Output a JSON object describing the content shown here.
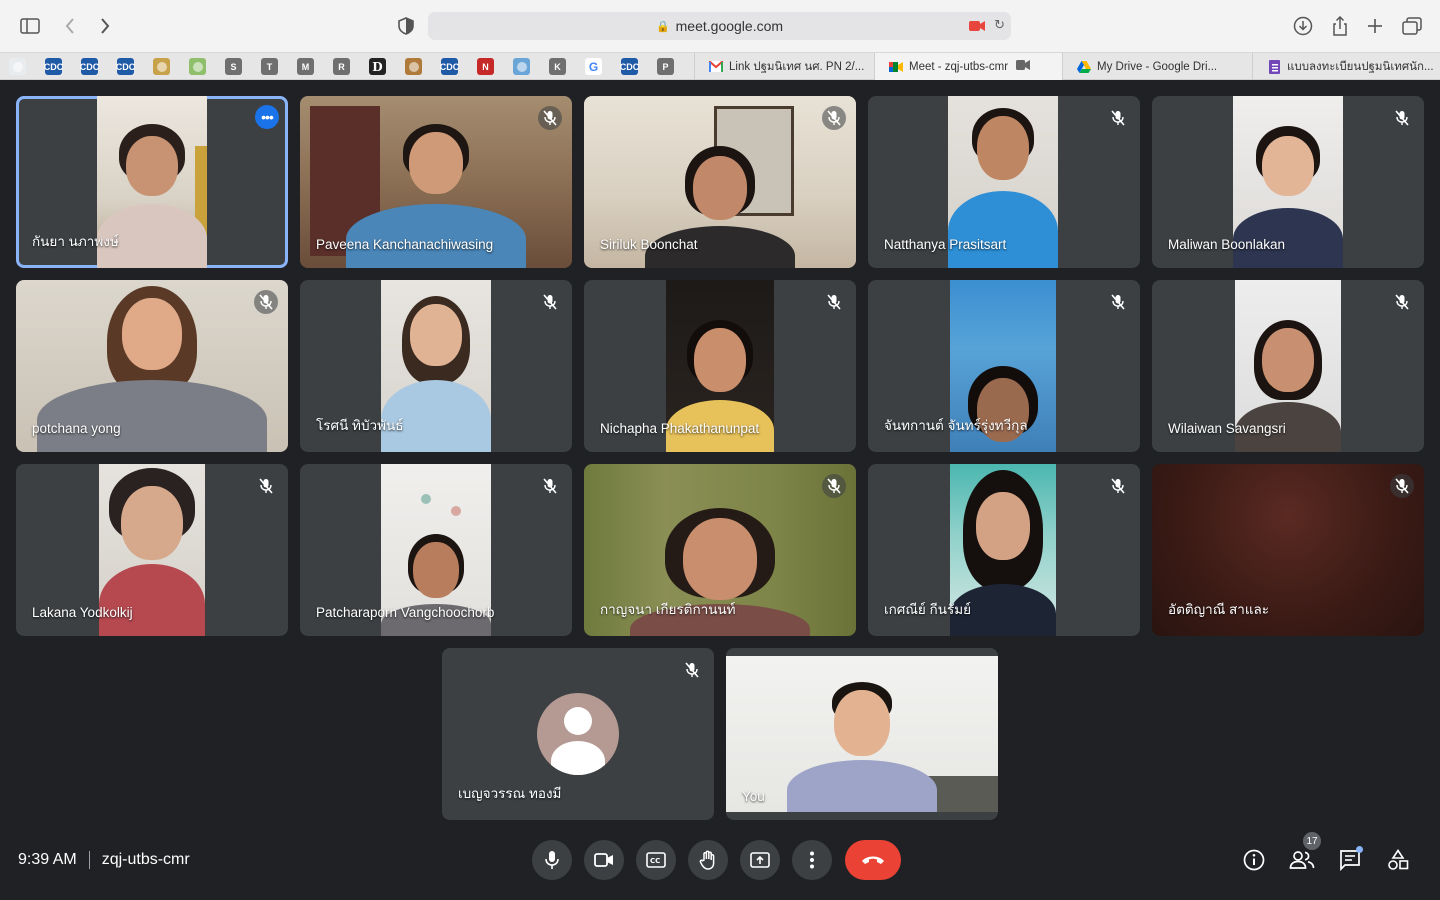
{
  "browser": {
    "url": "meet.google.com",
    "pinned_tabs": [
      {
        "label": "",
        "color": "#e9ecef",
        "icon": "heart-icon"
      },
      {
        "label": "CDC",
        "color": "#1f5aa6"
      },
      {
        "label": "CDC",
        "color": "#1f5aa6"
      },
      {
        "label": "CDC",
        "color": "#1f5aa6"
      },
      {
        "label": "",
        "color": "#c8a24a",
        "icon": "seal-icon"
      },
      {
        "label": "",
        "color": "#8fbf6a",
        "icon": "globe-icon"
      },
      {
        "label": "S",
        "color": "#6f6f6f"
      },
      {
        "label": "T",
        "color": "#6f6f6f"
      },
      {
        "label": "M",
        "color": "#6f6f6f"
      },
      {
        "label": "R",
        "color": "#6f6f6f"
      },
      {
        "label": "D",
        "color": "#222222"
      },
      {
        "label": "",
        "color": "#b07a3a",
        "icon": "crest-icon"
      },
      {
        "label": "CDC",
        "color": "#1f5aa6"
      },
      {
        "label": "N",
        "color": "#c62828"
      },
      {
        "label": "",
        "color": "#6aa5d8",
        "icon": "un-icon"
      },
      {
        "label": "K",
        "color": "#6f6f6f"
      },
      {
        "label": "G",
        "color": "#ffffff"
      },
      {
        "label": "CDC",
        "color": "#1f5aa6"
      },
      {
        "label": "P",
        "color": "#6f6f6f"
      }
    ],
    "tabs": [
      {
        "title": "Link ปฐมนิเทศ นศ. PN 2/...",
        "icon": "gmail-icon",
        "active": false
      },
      {
        "title": "Meet - zqj-utbs-cmr",
        "icon": "meet-icon",
        "active": true
      },
      {
        "title": "My Drive - Google Dri...",
        "icon": "drive-icon",
        "active": false
      },
      {
        "title": "แบบลงทะเบียนปฐมนิเทศนัก...",
        "icon": "forms-icon",
        "active": false
      }
    ]
  },
  "participants": [
    {
      "name": "กันยา นภาพงษ์",
      "muted": false,
      "highlight": true
    },
    {
      "name": "Paveena Kanchanachiwasing",
      "muted": true
    },
    {
      "name": "Siriluk Boonchat",
      "muted": true
    },
    {
      "name": "Natthanya Prasitsart",
      "muted": true
    },
    {
      "name": "Maliwan Boonlakan",
      "muted": true
    },
    {
      "name": "potchana yong",
      "muted": true
    },
    {
      "name": "โรศนี ทิบัวพันธ์",
      "muted": true
    },
    {
      "name": "Nichapha Phakathanunpat",
      "muted": true
    },
    {
      "name": "จันทกานต์ จันทร์รุ่งทวีกุล",
      "muted": true
    },
    {
      "name": "Wilaiwan Savangsri",
      "muted": true
    },
    {
      "name": "Lakana Yodkolkij",
      "muted": true
    },
    {
      "name": "Patcharaporn Vangchoochorb",
      "muted": true
    },
    {
      "name": "กาญจนา เกียรติกานนท์",
      "muted": true
    },
    {
      "name": "เกศณีย์ กีนรัมย์",
      "muted": true
    },
    {
      "name": "อัตติญาณี สาและ",
      "muted": true
    },
    {
      "name": "เบญจวรรณ ทองมี",
      "muted": true
    },
    {
      "name": "You",
      "muted": false
    }
  ],
  "meeting": {
    "time": "9:39 AM",
    "code": "zqj-utbs-cmr",
    "participant_count": "17"
  },
  "colors": {
    "background": "#202124",
    "tile": "#3c4043",
    "hangup": "#ea4335",
    "highlight": "#8ab4f8",
    "accent": "#1a73e8"
  }
}
